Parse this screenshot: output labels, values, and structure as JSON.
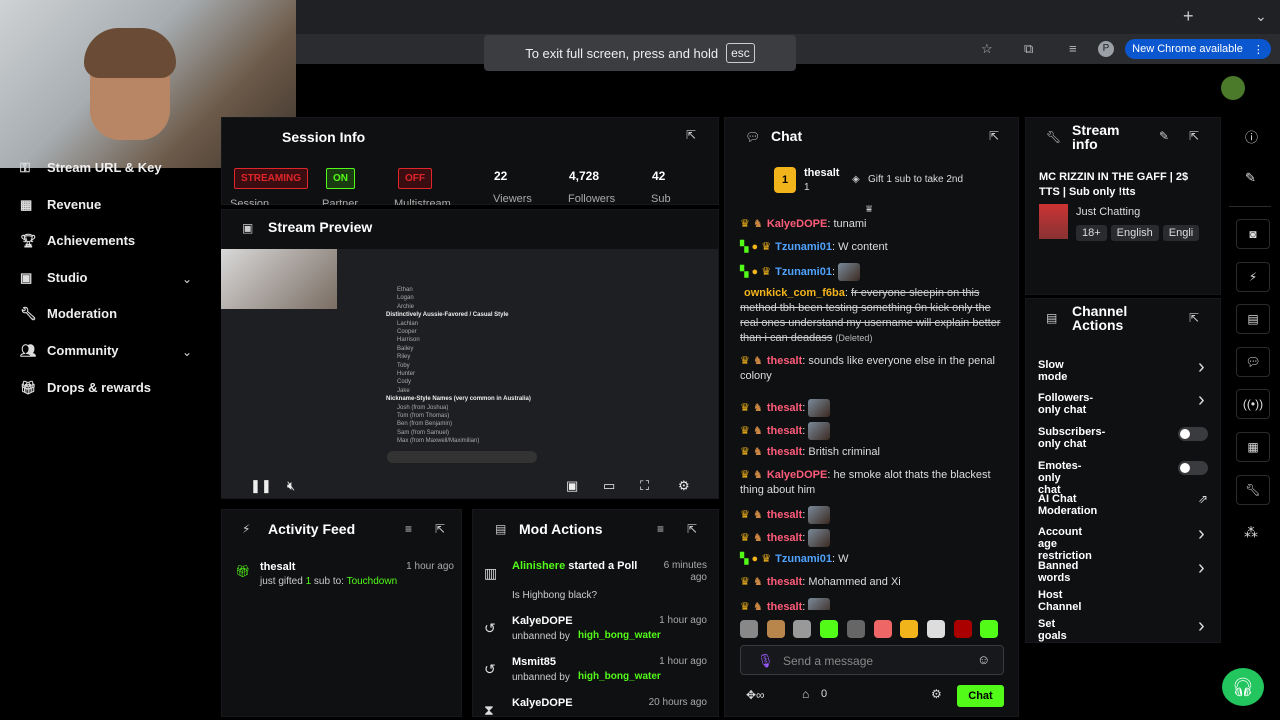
{
  "browser": {
    "fullscreen_notice": "To exit full screen, press and hold",
    "fullscreen_key": "esc",
    "new_chrome": "New Chrome available",
    "profile_initial": "P"
  },
  "sidebar": {
    "items": [
      {
        "label": "Stream URL & Key",
        "icon": "key-icon"
      },
      {
        "label": "Revenue",
        "icon": "revenue-icon"
      },
      {
        "label": "Achievements",
        "icon": "trophy-icon"
      },
      {
        "label": "Studio",
        "icon": "studio-icon",
        "expandable": true
      },
      {
        "label": "Moderation",
        "icon": "wrench-icon"
      },
      {
        "label": "Community",
        "icon": "community-icon",
        "expandable": true
      },
      {
        "label": "Drops & rewards",
        "icon": "gift-icon"
      }
    ]
  },
  "session": {
    "title": "Session Info",
    "badges": [
      {
        "label": "STREAMING",
        "sublabel": "Session",
        "color": "#e0252b"
      },
      {
        "label": "ON",
        "sublabel": "Partner",
        "color": "#53fc18"
      },
      {
        "label": "OFF",
        "sublabel": "Multistream",
        "color": "#e0252b"
      }
    ],
    "stats": [
      {
        "value": "22",
        "label": "Viewers"
      },
      {
        "value": "4,728",
        "label": "Followers"
      },
      {
        "value": "42",
        "label": "Sub"
      }
    ]
  },
  "preview": {
    "title": "Stream Preview",
    "screen_lines": [
      "Ethan",
      "Logan",
      "Archie",
      "Distinctively Aussie-Favored / Casual Style",
      "Lachlan",
      "Cooper",
      "Harrison",
      "Bailey",
      "Riley",
      "Toby",
      "Hunter",
      "Cody",
      "Jake",
      "Nickname-Style Names (very common in Australia)",
      "Josh (from Joshua)",
      "Tom (from Thomas)",
      "Ben (from Benjamin)",
      "Sam (from Samuel)",
      "Max (from Maxwell/Maximilian)"
    ]
  },
  "activity": {
    "title": "Activity Feed",
    "items": [
      {
        "user": "thesalt",
        "text_pre": "just gifted ",
        "count": "1",
        "text_mid": " sub to: ",
        "target": "Touchdown",
        "time": "1 hour ago"
      }
    ]
  },
  "modactions": {
    "title": "Mod Actions",
    "items": [
      {
        "user": "Alinishere",
        "action": "started a Poll",
        "detail": "Is Highbong black?",
        "time": "6 minutes ago",
        "icon": "poll-icon"
      },
      {
        "user": "KalyeDOPE",
        "action": "unbanned by",
        "detail": "high_bong_water",
        "time": "1 hour ago",
        "icon": "undo-icon"
      },
      {
        "user": "Msmit85",
        "action": "unbanned by",
        "detail": "high_bong_water",
        "time": "1 hour ago",
        "icon": "undo-icon"
      },
      {
        "user": "KalyeDOPE",
        "action": "",
        "detail": "",
        "time": "20 hours ago",
        "icon": "hourglass-icon"
      }
    ]
  },
  "chat": {
    "title": "Chat",
    "pinned": {
      "user": "thesalt",
      "count": "1",
      "rank": "1",
      "gift_text": "Gift 1 sub to take 2nd"
    },
    "messages": [
      {
        "user": "KalyeDOPE",
        "color": "#ff5c7a",
        "text": "tunami"
      },
      {
        "user": "Tzunami01",
        "color": "#4fa3ff",
        "text": "W content"
      },
      {
        "user": "Tzunami01",
        "color": "#4fa3ff",
        "text": ""
      },
      {
        "user": "ownkick_com_f6ba",
        "color": "#f2b41b",
        "text": "fr everyone sleepin on this method tbh been testing something 0n kick only the real ones understand my username will explain better than i can deadass",
        "deleted": "(Deleted)"
      },
      {
        "user": "thesalt",
        "color": "#ff5c7a",
        "text": "sounds like everyone else in the penal colony"
      },
      {
        "user": "thesalt",
        "color": "#ff5c7a",
        "text": ""
      },
      {
        "user": "thesalt",
        "color": "#ff5c7a",
        "text": ""
      },
      {
        "user": "thesalt",
        "color": "#ff5c7a",
        "text": "British criminal"
      },
      {
        "user": "KalyeDOPE",
        "color": "#ff5c7a",
        "text": "he smoke alot thats the blackest thing about him"
      },
      {
        "user": "thesalt",
        "color": "#ff5c7a",
        "text": ""
      },
      {
        "user": "thesalt",
        "color": "#ff5c7a",
        "text": ""
      },
      {
        "user": "Tzunami01",
        "color": "#4fa3ff",
        "text": "W"
      },
      {
        "user": "thesalt",
        "color": "#ff5c7a",
        "text": "Mohammed and Xi"
      },
      {
        "user": "thesalt",
        "color": "#ff5c7a",
        "text": ""
      }
    ],
    "input_placeholder": "Send a message",
    "send_label": "Chat",
    "counter": "0"
  },
  "streaminfo": {
    "title": "Stream info",
    "stream_title": "MC RIZZIN IN THE GAFF | 2$ TTS | Sub only !tts",
    "category": "Just Chatting",
    "tags": [
      "18+",
      "English",
      "Engli"
    ]
  },
  "channelactions": {
    "title": "Channel Actions",
    "items": [
      {
        "label": "Slow mode",
        "control": "arrow"
      },
      {
        "label": "Followers-only chat",
        "control": "arrow"
      },
      {
        "label": "Subscribers-only chat",
        "control": "toggle"
      },
      {
        "label": "Emotes-only chat",
        "control": "toggle"
      },
      {
        "label": "AI Chat Moderation",
        "control": "external"
      },
      {
        "label": "Account age restriction",
        "control": "arrow"
      },
      {
        "label": "Banned words",
        "control": "arrow"
      },
      {
        "label": "Host Channel",
        "control": "none"
      },
      {
        "label": "Set goals",
        "control": "arrow"
      }
    ]
  },
  "colors": {
    "accent": "#53fc18",
    "panel": "#0f1012",
    "danger": "#e0252b"
  }
}
